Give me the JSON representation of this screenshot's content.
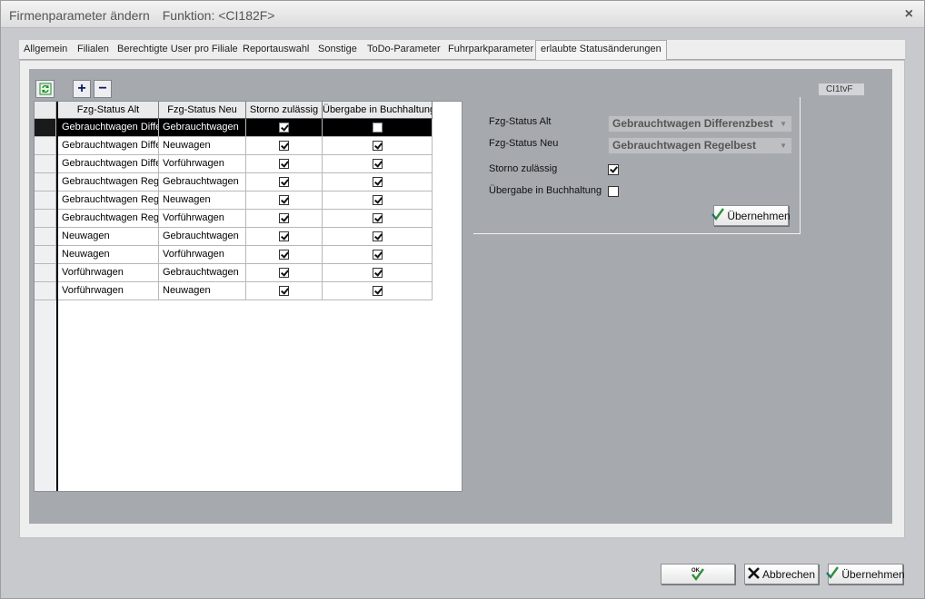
{
  "window": {
    "title": "Firmenparameter ändern",
    "function_label": "Funktion: <CI182F>",
    "close_glyph": "×"
  },
  "tabs": [
    {
      "label": "Allgemein"
    },
    {
      "label": "Filialen"
    },
    {
      "label": "Berechtigte User pro Filiale"
    },
    {
      "label": "Reportauswahl"
    },
    {
      "label": "Sonstige"
    },
    {
      "label": "ToDo-Parameter"
    },
    {
      "label": "Fuhrparkparameter"
    },
    {
      "label": "erlaubte Statusänderungen",
      "active": true
    }
  ],
  "toolbar": {
    "refresh_icon": "refresh-icon",
    "add_glyph": "+",
    "remove_glyph": "−"
  },
  "form_code": "CI1tvF",
  "grid": {
    "columns": [
      "Fzg-Status Alt",
      "Fzg-Status Neu",
      "Storno zulässig",
      "Übergabe in Buchhaltung"
    ],
    "rows": [
      {
        "alt": "Gebrauchtwagen Diffe",
        "neu": "Gebrauchtwagen",
        "storno": true,
        "uebergabe": false
      },
      {
        "alt": "Gebrauchtwagen Diffe",
        "neu": "Neuwagen",
        "storno": true,
        "uebergabe": true
      },
      {
        "alt": "Gebrauchtwagen Diffe",
        "neu": "Vorführwagen",
        "storno": true,
        "uebergabe": true
      },
      {
        "alt": "Gebrauchtwagen Rege",
        "neu": "Gebrauchtwagen",
        "storno": true,
        "uebergabe": true
      },
      {
        "alt": "Gebrauchtwagen Rege",
        "neu": "Neuwagen",
        "storno": true,
        "uebergabe": true
      },
      {
        "alt": "Gebrauchtwagen Rege",
        "neu": "Vorführwagen",
        "storno": true,
        "uebergabe": true
      },
      {
        "alt": "Neuwagen",
        "neu": "Gebrauchtwagen",
        "storno": true,
        "uebergabe": true
      },
      {
        "alt": "Neuwagen",
        "neu": "Vorführwagen",
        "storno": true,
        "uebergabe": true
      },
      {
        "alt": "Vorführwagen",
        "neu": "Gebrauchtwagen",
        "storno": true,
        "uebergabe": true
      },
      {
        "alt": "Vorführwagen",
        "neu": "Neuwagen",
        "storno": true,
        "uebergabe": true
      }
    ],
    "selected_row": 0
  },
  "detail": {
    "alt_label": "Fzg-Status Alt",
    "alt_value": "Gebrauchtwagen Differenzbest",
    "neu_label": "Fzg-Status Neu",
    "neu_value": "Gebrauchtwagen Regelbest",
    "storno_label": "Storno zulässig",
    "storno_checked": true,
    "uebergabe_label": "Übergabe in Buchhaltung",
    "uebergabe_checked": false,
    "apply_label": "Übernehmen",
    "combo_arrow": "▼"
  },
  "footer": {
    "ok_label": "OK",
    "cancel_label": "Abbrechen",
    "apply_label": "Übernehmen"
  },
  "colors": {
    "panel": "#a6a9ae",
    "selected_row": "#000000",
    "check_icon": "#2f8f3a"
  }
}
